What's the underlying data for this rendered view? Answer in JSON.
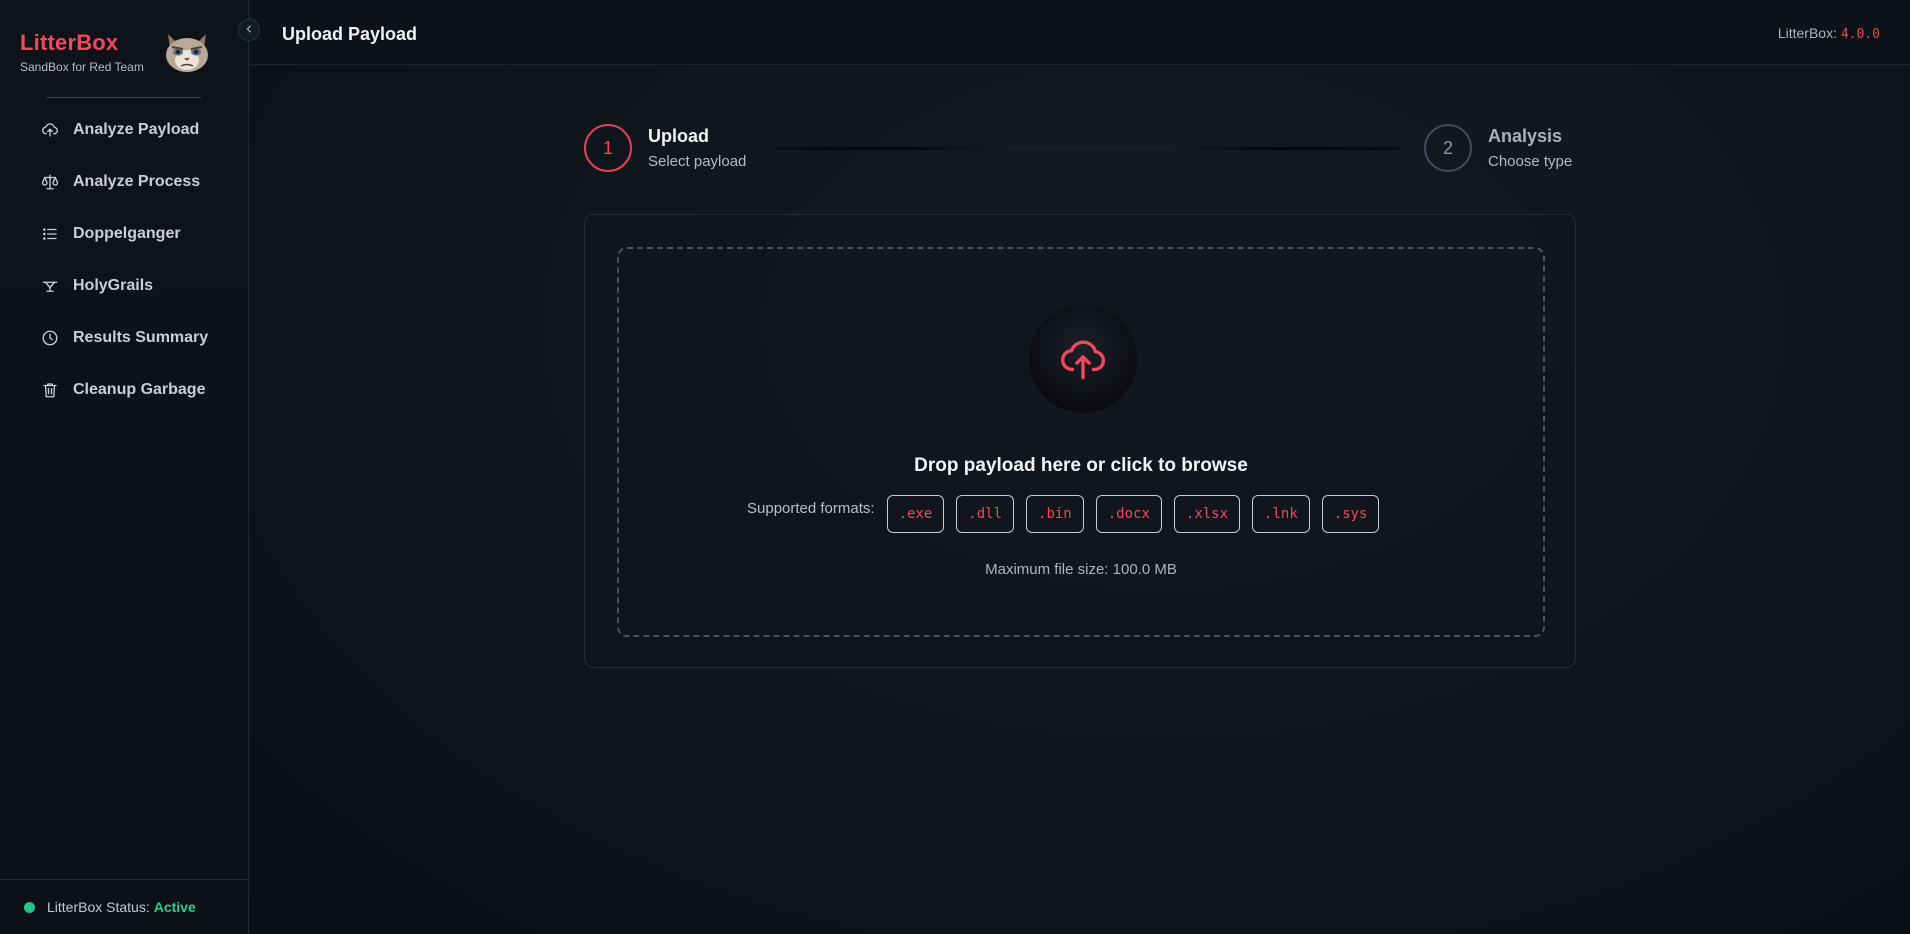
{
  "brand": {
    "name": "LitterBox",
    "tagline": "SandBox for Red Team"
  },
  "sidebar": {
    "collapse_icon": "chevron-left-icon",
    "items": [
      {
        "label": "Analyze Payload",
        "icon": "cloud-upload-icon"
      },
      {
        "label": "Analyze Process",
        "icon": "scale-icon"
      },
      {
        "label": "Doppelganger",
        "icon": "list-icon"
      },
      {
        "label": "HolyGrails",
        "icon": "grail-icon"
      },
      {
        "label": "Results Summary",
        "icon": "clock-icon"
      },
      {
        "label": "Cleanup Garbage",
        "icon": "trash-icon"
      }
    ],
    "status": {
      "label": "LitterBox Status:",
      "value": "Active",
      "color": "#2ecc8f"
    }
  },
  "header": {
    "title": "Upload Payload",
    "version_label": "LitterBox:",
    "version_value": "4.0.0"
  },
  "stepper": [
    {
      "number": "1",
      "title": "Upload",
      "subtitle": "Select payload",
      "active": true
    },
    {
      "number": "2",
      "title": "Analysis",
      "subtitle": "Choose type",
      "active": false
    }
  ],
  "upload": {
    "icon": "cloud-upload-icon",
    "title": "Drop payload here or click to browse",
    "formats_label": "Supported formats:",
    "formats": [
      ".exe",
      ".dll",
      ".bin",
      ".docx",
      ".xlsx",
      ".lnk",
      ".sys"
    ],
    "max_size": "Maximum file size: 100.0 MB"
  },
  "colors": {
    "accent": "#ef4a5c",
    "background": "#0f141c",
    "success": "#2ecc8f"
  }
}
